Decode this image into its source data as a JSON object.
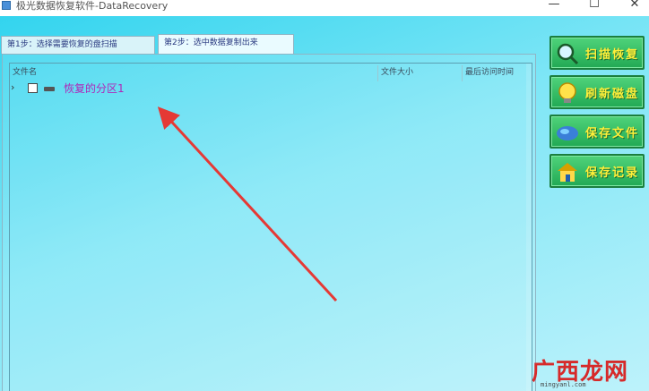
{
  "window": {
    "title": "极光数据恢复软件-DataRecovery",
    "minimize": "—",
    "maximize": "☐",
    "close": "✕"
  },
  "tabs": [
    {
      "label": "第1步：选择需要恢复的盘扫描"
    },
    {
      "label": "第2步：选中数据复制出来",
      "active": true
    }
  ],
  "file_list": {
    "columns": [
      "文件名",
      "文件大小",
      "最后访问时间"
    ],
    "rows": [
      {
        "label": "恢复的分区1",
        "expanded": false,
        "checked": false,
        "icon": "drive-icon"
      }
    ]
  },
  "side_buttons": [
    {
      "label": "扫描恢复",
      "icon": "magnifier-icon"
    },
    {
      "label": "刷新磁盘",
      "icon": "lightbulb-icon"
    },
    {
      "label": "保存文件",
      "icon": "globe-icon"
    },
    {
      "label": "保存记录",
      "icon": "house-icon"
    }
  ],
  "watermark": {
    "text": "广西龙网",
    "sub": "mingyanl.com"
  },
  "colors": {
    "accent_purple": "#b026b8",
    "button_green": "#22a954",
    "button_text": "#ffef3a",
    "arrow_red": "#e53935"
  }
}
